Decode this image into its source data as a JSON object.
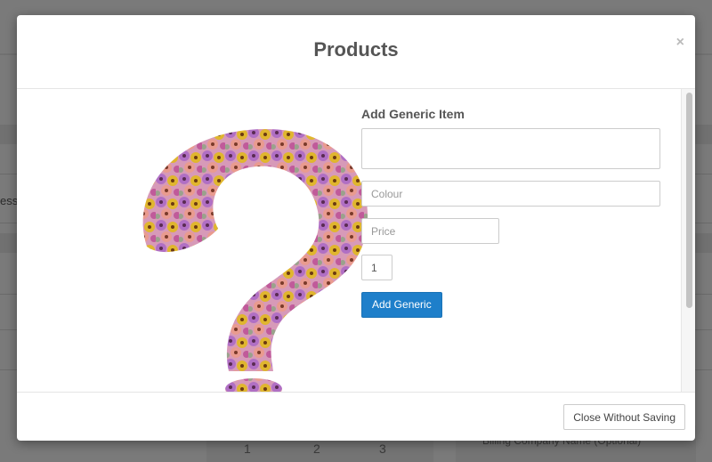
{
  "background": {
    "left_text": "ess S",
    "bottom_numbers": [
      "1",
      "2",
      "3"
    ],
    "billing_placeholder": "Billing Company Name (Optional)"
  },
  "modal": {
    "title": "Products",
    "close_symbol": "×",
    "form": {
      "title": "Add Generic Item",
      "description_value": "",
      "colour_placeholder": "Colour",
      "price_placeholder": "Price",
      "quantity_value": "1",
      "add_button_label": "Add Generic"
    },
    "footer": {
      "close_without_saving_label": "Close Without Saving"
    }
  },
  "colors": {
    "primary_button": "#1e7fca",
    "overlay": "rgba(0,0,0,0.5)"
  }
}
